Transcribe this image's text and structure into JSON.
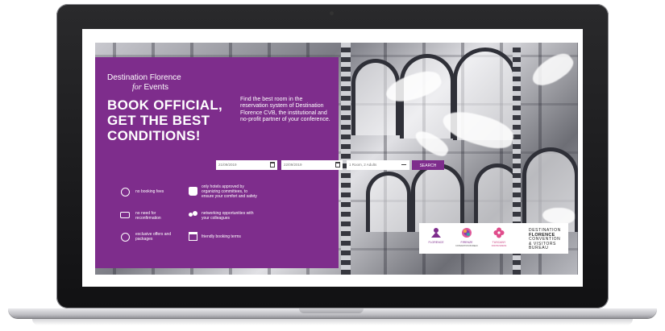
{
  "panel": {
    "brand_line1": "Destination Florence",
    "brand_for": "for",
    "brand_events": "Events",
    "headline": "BOOK OFFICIAL, GET THE BEST CONDITIONS!",
    "description": "Find the best room in the reservation system of Destination Florence CVB, the institutional and no-profit partner of your conference."
  },
  "search": {
    "checkin": "21/09/2019",
    "checkout": "22/09/2019",
    "guests": "1 Room, 2 Adults",
    "button": "SEARCH"
  },
  "features": [
    {
      "icon": "no-fees-icon",
      "text": "no booking fees"
    },
    {
      "icon": "thumbs-up-icon",
      "text": "only hotels approved by organizing committees, to ensure your comfort and safety"
    },
    {
      "icon": "money-icon",
      "text": "no need for reconfirmation"
    },
    {
      "icon": "people-icon",
      "text": "networking opportunities with your colleagues"
    },
    {
      "icon": "offers-icon",
      "text": "exclusive offers and packages"
    },
    {
      "icon": "calendar-icon",
      "text": "friendly booking terms"
    }
  ],
  "logos": {
    "destination_florence": "FLORENCE",
    "firenze": "FIRENZE",
    "firenze_sub": "CONVENTION BUREAU",
    "tuscany": "TUSCANY",
    "tuscany_sub": "FOR BUSINESS",
    "dfcvb_line1": "DESTINATION",
    "dfcvb_line2": "FLORENCE",
    "dfcvb_line3": "CONVENTION",
    "dfcvb_line4": "& VISITORS",
    "dfcvb_line5": "BUREAU"
  },
  "colors": {
    "brand_purple": "#7e2d8c",
    "laptop_frame": "#111113"
  }
}
